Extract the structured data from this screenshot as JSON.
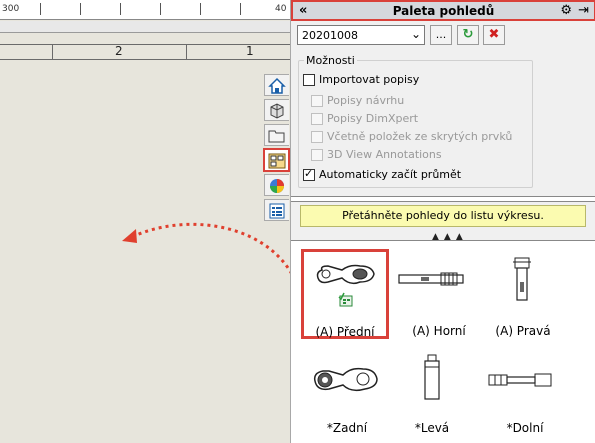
{
  "ruler": {
    "left_label": "300",
    "right_label": "40"
  },
  "sheet": {
    "zone_left": "2",
    "zone_right": "1"
  },
  "taskpane": {
    "tabs": [
      "home-icon",
      "parts-icon",
      "folder-icon",
      "view-palette-icon",
      "appearances-icon",
      "properties-icon"
    ],
    "active_tab": "view-palette-icon"
  },
  "panel": {
    "title": "Paleta pohledů",
    "collapse_icon": "«",
    "gear_icon": "⚙",
    "pin_icon": "⇥",
    "combo_value": "20201008",
    "browse_label": "...",
    "refresh_icon": "↻",
    "clear_icon": "✖",
    "options_legend": "Možnosti",
    "options": [
      {
        "label": "Importovat popisy",
        "checked": false,
        "enabled": true
      },
      {
        "label": "Popisy návrhu",
        "checked": false,
        "enabled": false
      },
      {
        "label": "Popisy DimXpert",
        "checked": false,
        "enabled": false
      },
      {
        "label": "Včetně položek ze skrytých prvků",
        "checked": false,
        "enabled": false
      },
      {
        "label": "3D View Annotations",
        "checked": false,
        "enabled": false
      },
      {
        "label": "Automaticky začít průmět",
        "checked": true,
        "enabled": true
      }
    ],
    "banner": "Přetáhněte pohledy do listu výkresu.",
    "views": [
      {
        "label": "(A) Přední",
        "selected": true
      },
      {
        "label": "(A) Horní",
        "selected": false
      },
      {
        "label": "(A) Pravá",
        "selected": false
      },
      {
        "label": "*Zadní",
        "selected": false
      },
      {
        "label": "*Levá",
        "selected": false
      },
      {
        "label": "*Dolní",
        "selected": false
      }
    ]
  },
  "colors": {
    "highlight": "#d9413a",
    "banner": "#fbfbb0",
    "refresh": "#2a9a3a",
    "clear": "#d02020"
  }
}
